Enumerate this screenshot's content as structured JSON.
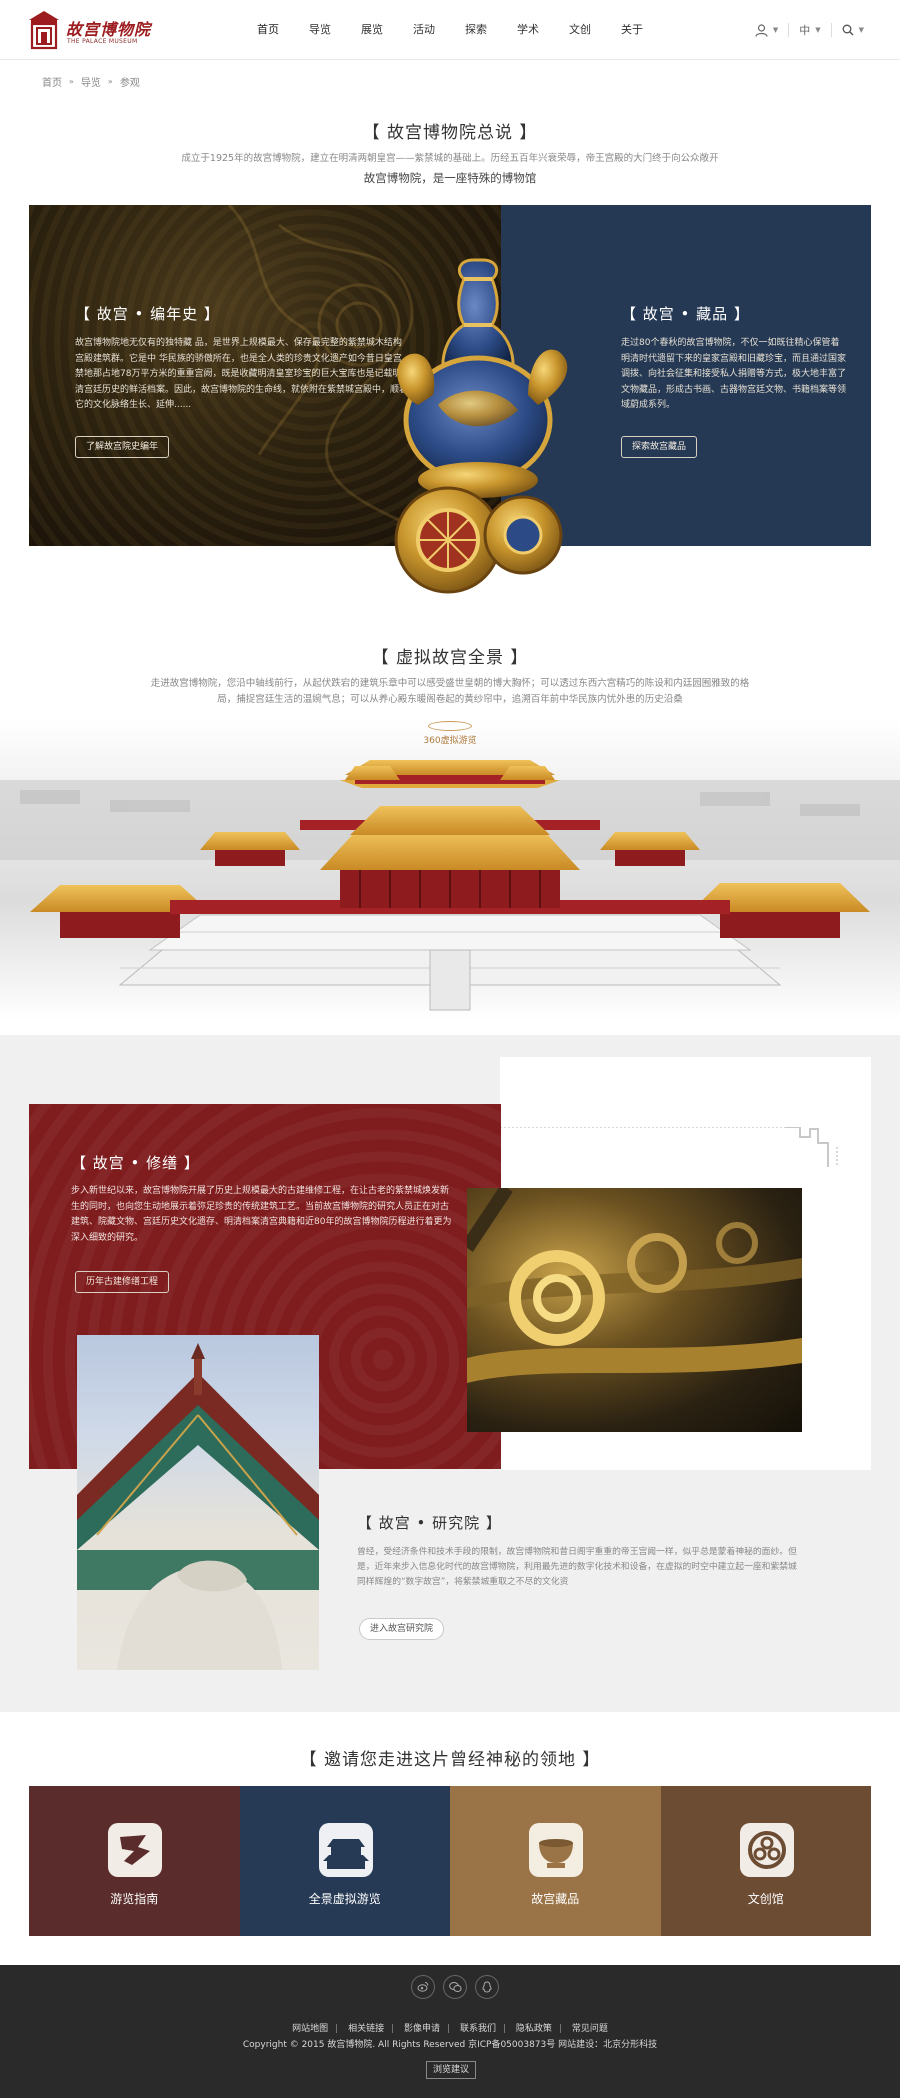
{
  "header": {
    "logo_cn": "故宫博物院",
    "logo_en": "THE PALACE MUSEUM",
    "nav": [
      "首页",
      "导览",
      "展览",
      "活动",
      "探索",
      "学术",
      "文创",
      "关于"
    ],
    "lang": "中",
    "icons": [
      "user-icon",
      "search-icon"
    ]
  },
  "breadcrumb": [
    "首页",
    "导览",
    "参观"
  ],
  "overview": {
    "title": "【 故宫博物院总说 】",
    "desc": "成立于1925年的故宫博物院，建立在明清两朝皇宫——紫禁城的基础上。历经五百年兴衰荣辱，帝王宫殿的大门终于向公众敞开",
    "subtitle": "故宫博物院，是一座特殊的博物馆",
    "left": {
      "heading": "【 故宫 • 编年史 】",
      "text": "故宫博物院地无仅有的独特藏 品，是世界上规模最大、保存最完整的紫禁城木结构宫殿建筑群。它是中 华民族的骄傲所在，也是全人类的珍贵文化遗产如今昔日皇宫禁地那占地78万平方米的重重宫阙，既是收藏明清皇室珍宝的巨大宝库也是记载明 清宫廷历史的鲜活档案。因此，故宫博物院的生命线，就依附在紫禁城宫殿中，顺着它的文化脉络生长、延伸......",
      "button": "了解故宫院史编年"
    },
    "right": {
      "heading": "【 故宫 • 藏品 】",
      "text": "走过80个春秋的故宫博物院，不仅一如既往精心保管着明清时代遗留下来的皇家宫殿和旧藏珍宝，而且通过国家调拨、向社会征集和接受私人捐赠等方式，极大地丰富了文物藏品，形成古书画、古器物宫廷文物、书籍档案等领域蔚成系列。",
      "button": "探索故宫藏品"
    }
  },
  "virtual": {
    "title": "【 虚拟故宫全景 】",
    "desc": "走进故宫博物院，您沿中轴线前行，从起伏跌宕的建筑乐章中可以感受盛世皇朝的博大胸怀；可以透过东西六宫精巧的陈设和内廷园囿雅致的格局，捕捉宫廷生活的温婉气息；可以从养心殿东暖阁卷起的黄纱帘中，追溯百年前中华民族内忧外患的历史沿桑",
    "pano_label": "360虚拟游览"
  },
  "restoration": {
    "heading": "【 故宫 • 修缮 】",
    "text": "步入新世纪以来，故宫博物院开展了历史上规模最大的古建维修工程，在让古老的紫禁城焕发新生的同时，也向您生动地展示着弥足珍贵的传统建筑工艺。当前故宫博物院的研究人员正在对古建筑、院藏文物、宫廷历史文化遗存、明清档案清宫典籍和近80年的故宫博物院历程进行着更为深入细致的研究。",
    "button": "历年古建修缮工程"
  },
  "research": {
    "heading": "【 故宫 • 研究院 】",
    "text": "曾经，受经济条件和技术手段的限制，故宫博物院和昔日阁宇重重的帝王宫阙一样，似乎总是蒙着神秘的面纱。但是，近年来步入信息化时代的故宫博物院，利用最先进的数字化技术和设备，在虚拟的时空中建立起一座和紫禁城同样辉煌的“数字故宫”，将紫禁城重取之不尽的文化资",
    "button": "进入故宫研究院"
  },
  "invite": {
    "title": "【 邀请您走进这片曾经神秘的领地 】",
    "tiles": [
      {
        "label": "游览指南",
        "color": "#5a2c2c",
        "icon": "guide-map-icon"
      },
      {
        "label": "全景虚拟游览",
        "color": "#263a55",
        "icon": "palace-panorama-icon"
      },
      {
        "label": "故宫藏品",
        "color": "#9a7446",
        "icon": "collection-bowl-icon"
      },
      {
        "label": "文创馆",
        "color": "#6d4c34",
        "icon": "cultural-creative-icon"
      }
    ]
  },
  "footer": {
    "links": [
      "网站地图",
      "相关链接",
      "影像申请",
      "联系我们",
      "隐私政策",
      "常见问题"
    ],
    "copyright": "Copyright © 2015 故宫博物院. All Rights Reserved  京ICP备05003873号    网站建设：北京分形科技",
    "feedback": "浏览建议",
    "social": [
      "weibo-icon",
      "wechat-icon",
      "qq-icon"
    ]
  },
  "colors": {
    "brand_red": "#9c1c1f",
    "navy": "#253954",
    "restoration_red": "#7f1c1e",
    "footer": "#2a2a2a"
  }
}
